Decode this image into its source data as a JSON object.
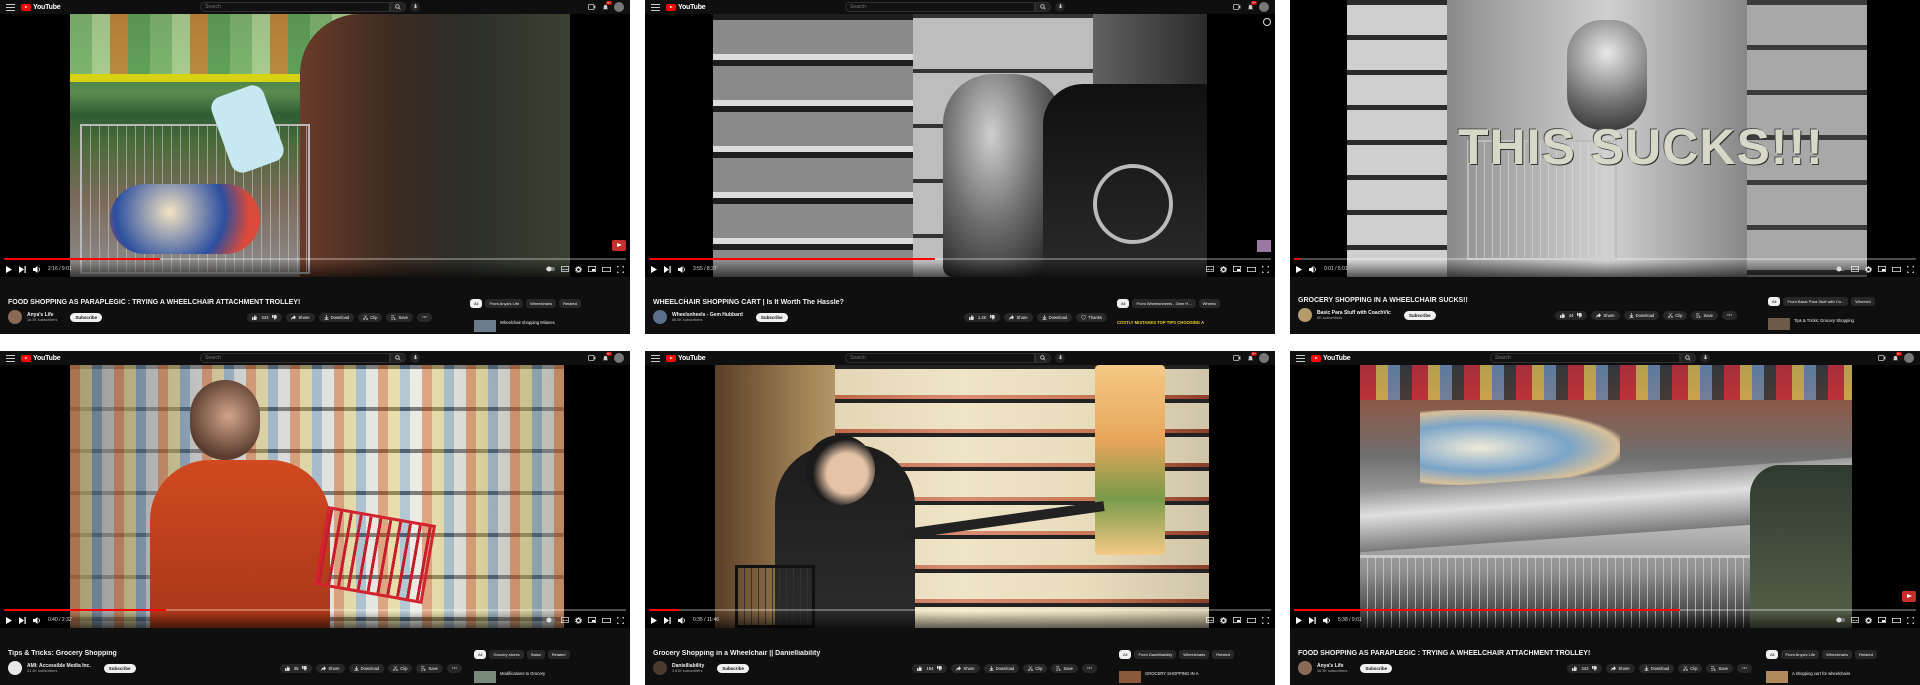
{
  "colors": {
    "brand": "#ff0000",
    "bg": "#0f0f0f",
    "pill": "#272727",
    "progress": "#ff0000"
  },
  "panels": [
    {
      "logo": "YouTube",
      "search_placeholder": "Search",
      "badge": "9+",
      "time": "2:16 / 9:01",
      "progress": 0.25,
      "title": "FOOD SHOPPING AS PARAPLEGIC : TRYING A WHEELCHAIR ATTACHMENT TROLLEY!",
      "channel": "Anya's Life",
      "subs": "16.3K subscribers",
      "subscribe": "Subscribe",
      "likes": "343",
      "share": "Share",
      "download": "Download",
      "clip": "Clip",
      "save": "Save",
      "chips": [
        "All",
        "From Anya's Life",
        "Wheelchairs",
        "Related"
      ],
      "rec_title": "Wheelchair shopping Milanes"
    },
    {
      "logo": "YouTube",
      "search_placeholder": "Search",
      "badge": "9+",
      "time": "3:55 / 8:27",
      "progress": 0.46,
      "title": "WHEELCHAIR SHOPPING CART | Is It Worth The Hassle?",
      "channel": "Wheelsnheels - Gem Hubbard",
      "subs": "86.5K subscribers",
      "subscribe": "Subscribe",
      "likes": "1.4K",
      "share": "Share",
      "download": "Download",
      "thanks": "Thanks",
      "chips": [
        "All",
        "From Wheelsnheels - Gem H...",
        "Wheelc"
      ],
      "rec_title": "COSTLY MISTAKES TOP TIPS CHOOSING A"
    },
    {
      "logo": "YouTube",
      "search_placeholder": "Search",
      "badge": "9+",
      "time": "0:01 / 5:01",
      "progress": 0.01,
      "overlay": "THIS SUCKS!!!",
      "title": "GROCERY SHOPPING IN A WHEELCHAIR SUCKS!!",
      "channel": "Basic Para Stuff with CoachVic",
      "subs": "6K subscribers",
      "subscribe": "Subscribe",
      "likes": "44",
      "share": "Share",
      "download": "Download",
      "clip": "Clip",
      "save": "Save",
      "chips": [
        "All",
        "From Basic Para Stuff with Co...",
        "Wheelch"
      ],
      "rec_title": "Tips & Tricks: Grocery Shopping"
    },
    {
      "logo": "YouTube",
      "search_placeholder": "Search",
      "badge": "9+",
      "time": "0:40 / 2:32",
      "progress": 0.26,
      "title": "Tips & Tricks: Grocery Shopping",
      "channel": "AMI: Accessible Media Inc.",
      "subs": "31.4K subscribers",
      "subscribe": "Subscribe",
      "likes": "35",
      "share": "Share",
      "download": "Download",
      "clip": "Clip",
      "save": "Save",
      "chips": [
        "All",
        "Grocery stores",
        "Salsa",
        "Related"
      ],
      "rec_title": "Modifications to Grocery"
    },
    {
      "logo": "YouTube",
      "search_placeholder": "Search",
      "badge": "9+",
      "time": "0:35 / 11:46",
      "progress": 0.05,
      "title": "Grocery Shopping in a Wheelchair || Danielliability",
      "channel": "Danielliability",
      "subs": "3.61K subscribers",
      "subscribe": "Subscribe",
      "likes": "194",
      "share": "Share",
      "download": "Download",
      "clip": "Clip",
      "save": "Save",
      "chips": [
        "All",
        "From Danielliability",
        "Wheelchairs",
        "Related"
      ],
      "rec_title": "GROCERY SHOPPING IN A"
    },
    {
      "logo": "YouTube",
      "search_placeholder": "Search",
      "badge": "9+",
      "time": "5:38 / 9:01",
      "progress": 0.62,
      "title": "FOOD SHOPPING AS PARAPLEGIC : TRYING A WHEELCHAIR ATTACHMENT TROLLEY!",
      "channel": "Anya's Life",
      "subs": "16.3K subscribers",
      "subscribe": "Subscribe",
      "likes": "343",
      "share": "Share",
      "download": "Download",
      "clip": "Clip",
      "save": "Save",
      "chips": [
        "All",
        "From Anya's Life",
        "Wheelchairs",
        "Related"
      ],
      "rec_title": "A shopping cart for wheelchairs"
    }
  ]
}
